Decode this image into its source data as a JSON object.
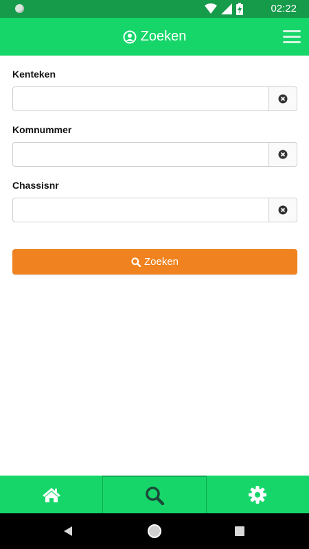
{
  "status_bar": {
    "time": "02:22"
  },
  "app_bar": {
    "title": "Zoeken"
  },
  "form": {
    "fields": [
      {
        "label": "Kenteken",
        "value": "",
        "placeholder": ""
      },
      {
        "label": "Komnummer",
        "value": "",
        "placeholder": ""
      },
      {
        "label": "Chassisnr",
        "value": "",
        "placeholder": ""
      }
    ],
    "submit_label": "Zoeken"
  },
  "tabs": [
    {
      "name": "home",
      "icon": "home-icon",
      "active": false
    },
    {
      "name": "search",
      "icon": "search-icon",
      "active": true
    },
    {
      "name": "settings",
      "icon": "gear-icon",
      "active": false
    }
  ],
  "colors": {
    "primary": "#16d66a",
    "status_bar": "#159b4a",
    "accent": "#f0831f",
    "active_tab_icon": "#1b4a3a"
  }
}
